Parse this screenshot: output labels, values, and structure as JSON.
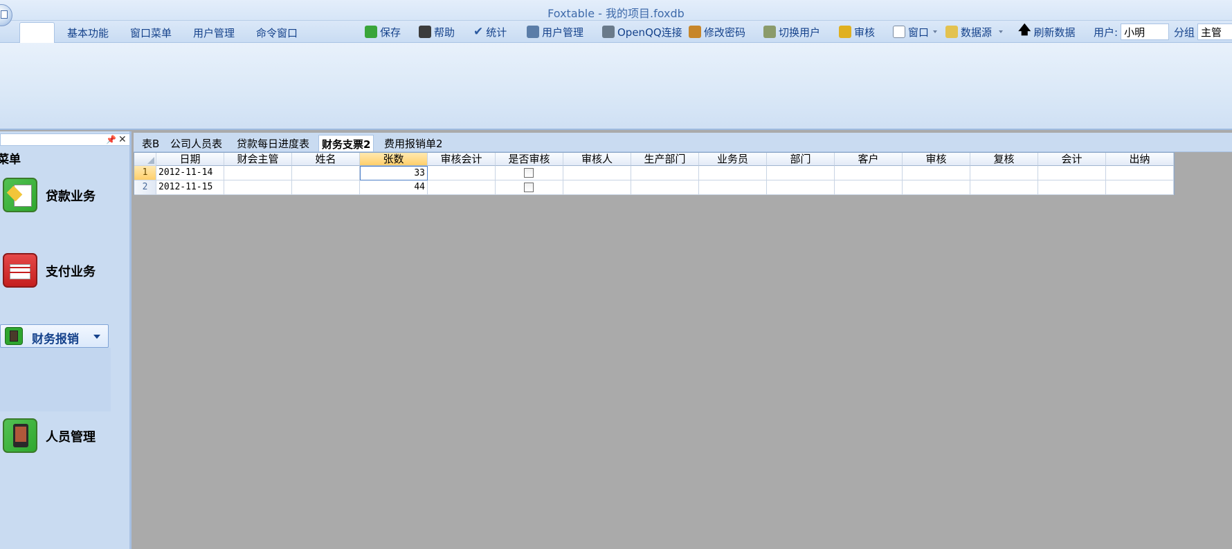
{
  "window": {
    "title": "Foxtable - 我的项目.foxdb"
  },
  "menu_tabs": [
    "基本功能",
    "窗口菜单",
    "用户管理",
    "命令窗口"
  ],
  "quick_access": {
    "save": "保存",
    "help": "帮助",
    "stats": "统计",
    "user_manage": "用户管理",
    "openqq": "OpenQQ连接",
    "change_password": "修改密码",
    "switch_user": "切换用户",
    "audit": "审核",
    "window": "窗口",
    "datasource": "数据源",
    "refresh": "刷新数据",
    "user_label": "用户:",
    "user_value": "小明",
    "group_label": "分组",
    "group_value": "主管"
  },
  "nav": {
    "title": "菜单",
    "items": [
      {
        "label": "贷款业务",
        "icon": "loan-document-icon",
        "color": "#2ea82e"
      },
      {
        "label": "支付业务",
        "icon": "calendar-icon",
        "color": "#d92b2b"
      },
      {
        "label": "财务报销",
        "icon": "calculator-icon",
        "color": "#2ea82e"
      },
      {
        "label": "人员管理",
        "icon": "tablet-icon",
        "color": "#2ea82e"
      }
    ]
  },
  "doc_tabs": [
    "表B",
    "公司人员表",
    "贷款每日进度表",
    "财务支票2",
    "费用报销单2"
  ],
  "grid": {
    "columns": [
      "日期",
      "财会主管",
      "姓名",
      "张数",
      "审核会计",
      "是否审核",
      "审核人",
      "生产部门",
      "业务员",
      "部门",
      "客户",
      "审核",
      "复核",
      "会计",
      "出纳"
    ],
    "rows": [
      {
        "num": "1",
        "date": "2012-11-14",
        "count": "33",
        "checked": false
      },
      {
        "num": "2",
        "date": "2012-11-15",
        "count": "44",
        "checked": false
      }
    ]
  },
  "colors": {
    "ribbon": "#d6e5f7",
    "accent": "#15428b",
    "workspace": "#aaaaaa",
    "selection": "#ffcf6b"
  }
}
